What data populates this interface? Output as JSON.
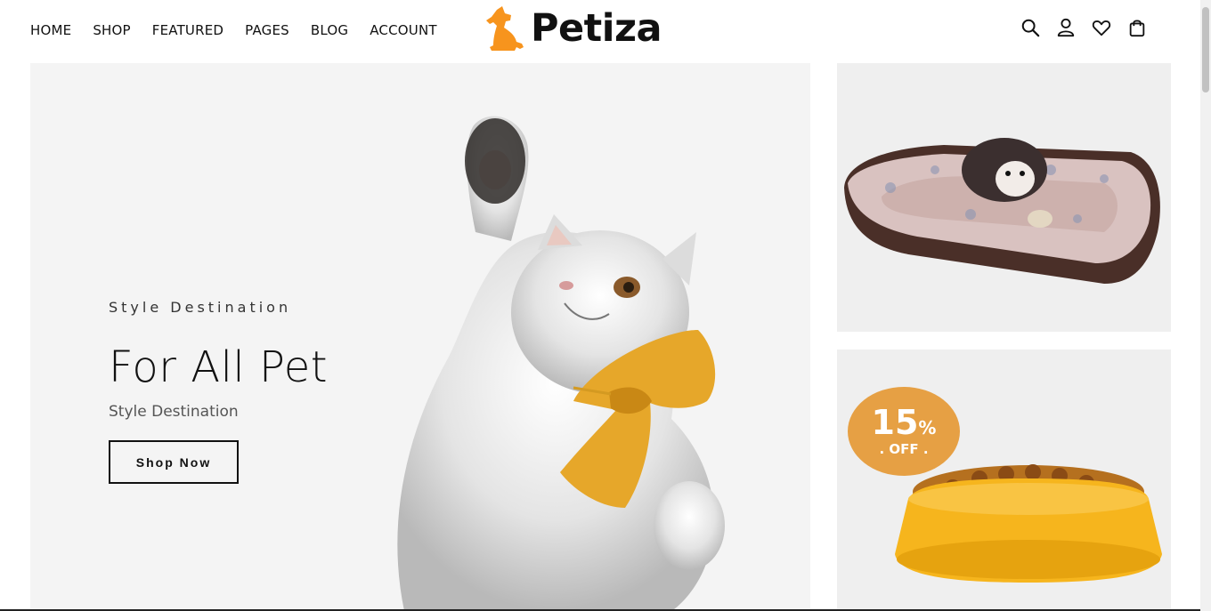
{
  "nav": {
    "items": [
      "HOME",
      "SHOP",
      "FEATURED",
      "PAGES",
      "BLOG",
      "ACCOUNT"
    ]
  },
  "brand": {
    "name": "Petiza",
    "accent_color": "#f7941d"
  },
  "header_icons": [
    "search-icon",
    "user-icon",
    "heart-icon",
    "bag-icon"
  ],
  "hero": {
    "eyebrow": "Style Destination",
    "title": "For All Pet",
    "subtitle": "Style Destination",
    "button_label": "Shop Now"
  },
  "promo": {
    "discount_percent": "15",
    "percent_sign": "%",
    "off_label": ". OFF ."
  },
  "colors": {
    "hero_bg": "#f4f4f4",
    "banner_bg": "#efefef",
    "badge": "#e6a044",
    "bowl": "#f6b51d"
  }
}
